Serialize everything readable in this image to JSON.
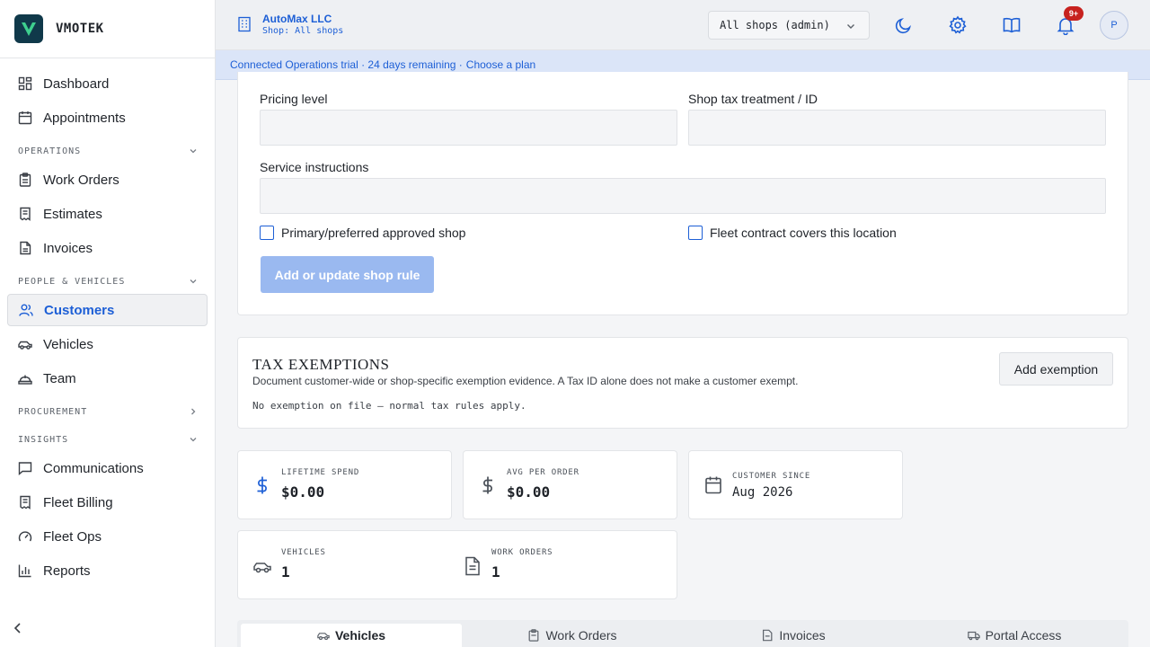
{
  "brand": {
    "name": "VMOTEK",
    "logo_letter": "V"
  },
  "sidebar": {
    "items": [
      {
        "label": "Dashboard",
        "icon": "dashboard-icon"
      },
      {
        "label": "Appointments",
        "icon": "calendar-icon"
      },
      {
        "label": "Work Orders",
        "icon": "clipboard-icon"
      },
      {
        "label": "Estimates",
        "icon": "receipt-icon"
      },
      {
        "label": "Invoices",
        "icon": "file-icon"
      },
      {
        "label": "Customers",
        "icon": "users-icon",
        "active": true
      },
      {
        "label": "Vehicles",
        "icon": "car-icon"
      },
      {
        "label": "Team",
        "icon": "helmet-icon"
      },
      {
        "label": "Communications",
        "icon": "message-icon"
      },
      {
        "label": "Fleet Billing",
        "icon": "receipt-icon"
      },
      {
        "label": "Fleet Ops",
        "icon": "gauge-icon"
      },
      {
        "label": "Reports",
        "icon": "bar-chart-icon"
      }
    ],
    "sections": [
      "OPERATIONS",
      "PEOPLE & VEHICLES",
      "PROCUREMENT",
      "INSIGHTS"
    ]
  },
  "header": {
    "company": "AutoMax LLC",
    "shop": "Shop: All shops",
    "shop_select": "All shops (admin)",
    "notification_badge": "9+",
    "avatar_initial": "P"
  },
  "trial_banner": {
    "text": "Connected Operations trial · 24 days remaining · ",
    "link": "Choose a plan"
  },
  "form": {
    "pricing_level_label": "Pricing level",
    "tax_treatment_label": "Shop tax treatment / ID",
    "service_instructions_label": "Service instructions",
    "primary_shop_label": "Primary/preferred approved shop",
    "fleet_contract_label": "Fleet contract covers this location",
    "submit_label": "Add or update shop rule"
  },
  "tax": {
    "title": "TAX EXEMPTIONS",
    "description": "Document customer-wide or shop-specific exemption evidence. A Tax ID alone does not make a customer exempt.",
    "note": "No exemption on file — normal tax rules apply.",
    "add_label": "Add exemption"
  },
  "stats": {
    "lifetime_label": "LIFETIME SPEND",
    "lifetime_value": "$0.00",
    "avg_label": "AVG PER ORDER",
    "avg_value": "$0.00",
    "since_label": "CUSTOMER SINCE",
    "since_value": "Aug 2026",
    "vehicles_label": "VEHICLES",
    "vehicles_value": "1",
    "orders_label": "WORK ORDERS",
    "orders_value": "1"
  },
  "tabs": [
    "Vehicles",
    "Work Orders",
    "Invoices",
    "Portal Access"
  ],
  "colors": {
    "accent": "#1d5fd6",
    "badge": "#c7221f",
    "logo_bg": "#10394a",
    "logo_fg": "#3ecf8e"
  }
}
